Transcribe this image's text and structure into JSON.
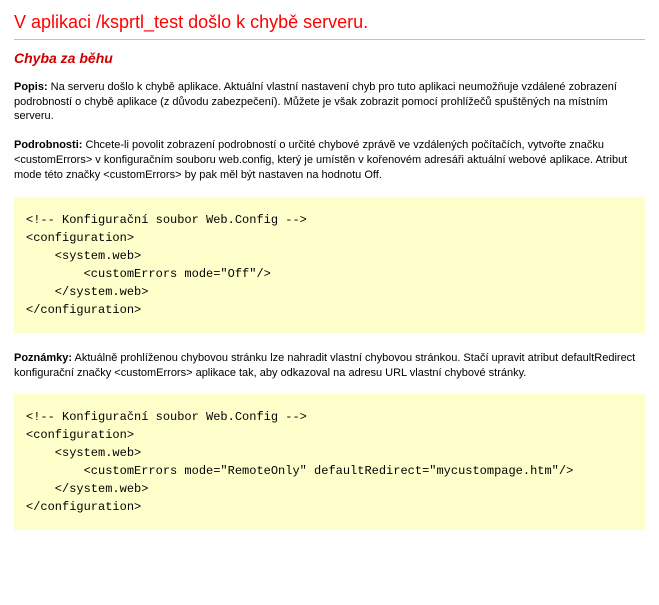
{
  "title": "V aplikaci /ksprtl_test došlo k chybě serveru.",
  "subtitle": "Chyba za běhu",
  "description": {
    "label": "Popis:",
    "text": " Na serveru došlo k chybě aplikace. Aktuální vlastní nastavení chyb pro tuto aplikaci neumožňuje vzdálené zobrazení podrobností o chybě aplikace (z důvodu zabezpečení). Můžete je však zobrazit pomocí prohlížečů spuštěných na místním serveru."
  },
  "details": {
    "label": "Podrobnosti:",
    "text": " Chcete-li povolit zobrazení podrobností o určité chybové zprávě ve vzdálených počítačích, vytvořte značku <customErrors> v konfiguračním souboru web.config, který je umístěn v kořenovém adresáři aktuální webové aplikace. Atribut mode této značky <customErrors> by pak měl být nastaven na hodnotu Off."
  },
  "code1": {
    "l0": "",
    "l1": "<!-- Konfigurační soubor Web.Config -->",
    "l2": "",
    "l3": "<configuration>",
    "l4": "    <system.web>",
    "l5": "        <customErrors mode=\"Off\"/>",
    "l6": "    </system.web>",
    "l7": "</configuration>"
  },
  "notes": {
    "label": "Poznámky:",
    "text": " Aktuálně prohlíženou chybovou stránku lze nahradit vlastní chybovou stránkou. Stačí upravit atribut defaultRedirect konfigurační značky <customErrors> aplikace tak, aby odkazoval na adresu URL vlastní chybové stránky."
  },
  "code2": {
    "l0": "",
    "l1": "<!-- Konfigurační soubor Web.Config -->",
    "l2": "",
    "l3": "<configuration>",
    "l4": "    <system.web>",
    "l5": "        <customErrors mode=\"RemoteOnly\" defaultRedirect=\"mycustompage.htm\"/>",
    "l6": "    </system.web>",
    "l7": "</configuration>"
  }
}
